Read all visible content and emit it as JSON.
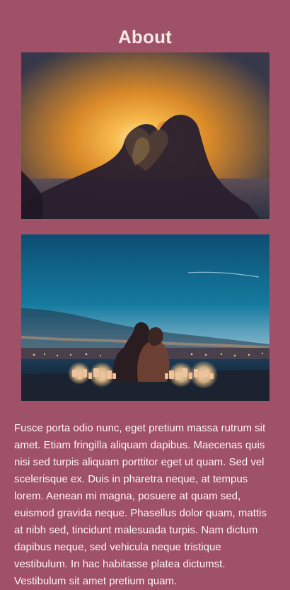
{
  "page": {
    "title": "About",
    "body": "Fusce porta odio nunc, eget pretium massa rutrum sit amet. Etiam fringilla aliquam dapibus. Maecenas quis nisi sed turpis aliquam porttitor eget ut quam. Sed vel scelerisque ex. Duis in pharetra neque, at tempus lorem. Aenean mi magna, posuere at quam sed, euismod gravida neque. Phasellus dolor quam, mattis at nibh sed, tincidunt malesuada turpis. Nam dictum dapibus neque, sed vehicula neque tristique vestibulum. In hac habitasse platea dictumst. Vestibulum sit amet pretium quam."
  },
  "colors": {
    "background": "#9f5168",
    "title": "#f6e8e3",
    "text": "#fff5f2"
  },
  "images": [
    {
      "name": "heart-hands-sunset-photo"
    },
    {
      "name": "couple-by-the-sea-photo"
    }
  ]
}
